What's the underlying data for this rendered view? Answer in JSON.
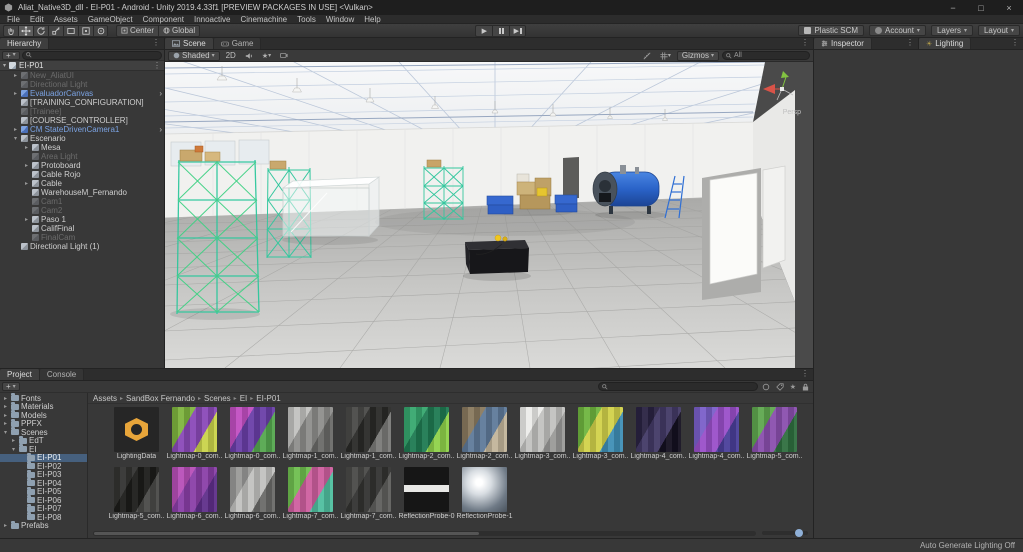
{
  "window": {
    "title": "Aliat_Native3D_dll - EI-P01 - Android - Unity 2019.4.33f1 [PREVIEW PACKAGES IN USE] <Vulkan>"
  },
  "menu": {
    "items": [
      "File",
      "Edit",
      "Assets",
      "GameObject",
      "Component",
      "Innoactive",
      "Cinemachine",
      "Tools",
      "Window",
      "Help"
    ]
  },
  "toolbar": {
    "pivot": "Center",
    "space": "Global",
    "plastic_scm": "Plastic SCM",
    "account": "Account",
    "layers": "Layers",
    "layout": "Layout"
  },
  "hierarchy": {
    "tab": "Hierarchy",
    "scene": "EI-P01",
    "items": [
      {
        "label": "New_AliatUI",
        "state": "disabled",
        "indent": 0,
        "arrow": "right",
        "prefab_open": false
      },
      {
        "label": "Directional Light",
        "state": "disabled",
        "indent": 0,
        "arrow": "none",
        "prefab_open": false
      },
      {
        "label": "EvaluadorCanvas",
        "state": "prefab",
        "indent": 0,
        "arrow": "right",
        "prefab_open": true
      },
      {
        "label": "[TRAINING_CONFIGURATION]",
        "state": "normal",
        "indent": 0,
        "arrow": "none",
        "prefab_open": false
      },
      {
        "label": "[Trainee]",
        "state": "disabled",
        "indent": 0,
        "arrow": "none",
        "prefab_open": false
      },
      {
        "label": "[COURSE_CONTROLLER]",
        "state": "normal",
        "indent": 0,
        "arrow": "none",
        "prefab_open": false
      },
      {
        "label": "CM StateDrivenCamera1",
        "state": "prefab",
        "indent": 0,
        "arrow": "right",
        "prefab_open": true
      },
      {
        "label": "Escenario",
        "state": "normal",
        "indent": 0,
        "arrow": "down",
        "prefab_open": false
      },
      {
        "label": "Mesa",
        "state": "normal",
        "indent": 1,
        "arrow": "right",
        "prefab_open": false
      },
      {
        "label": "Area Light",
        "state": "disabled",
        "indent": 1,
        "arrow": "none",
        "prefab_open": false
      },
      {
        "label": "Protoboard",
        "state": "normal",
        "indent": 1,
        "arrow": "right",
        "prefab_open": false
      },
      {
        "label": "Cable Rojo",
        "state": "normal",
        "indent": 1,
        "arrow": "none",
        "prefab_open": false
      },
      {
        "label": "Cable",
        "state": "normal",
        "indent": 1,
        "arrow": "right",
        "prefab_open": false
      },
      {
        "label": "WarehouseM_Fernando",
        "state": "normal",
        "indent": 1,
        "arrow": "none",
        "prefab_open": false
      },
      {
        "label": "Cam1",
        "state": "disabled",
        "indent": 1,
        "arrow": "none",
        "prefab_open": false
      },
      {
        "label": "Cam2",
        "state": "disabled",
        "indent": 1,
        "arrow": "none",
        "prefab_open": false
      },
      {
        "label": "Paso 1",
        "state": "normal",
        "indent": 1,
        "arrow": "right",
        "prefab_open": false
      },
      {
        "label": "CalifFinal",
        "state": "normal",
        "indent": 1,
        "arrow": "none",
        "prefab_open": false
      },
      {
        "label": "FinalCam",
        "state": "disabled",
        "indent": 1,
        "arrow": "none",
        "prefab_open": false
      },
      {
        "label": "Directional Light (1)",
        "state": "normal",
        "indent": 0,
        "arrow": "none",
        "prefab_open": false
      }
    ]
  },
  "scene_view": {
    "tabs": [
      {
        "label": "Scene",
        "active": true
      },
      {
        "label": "Game",
        "active": false
      }
    ],
    "shading": "Shaded",
    "toggle_2d": "2D",
    "gizmos": "Gizmos",
    "search_value": "All",
    "persp": "Persp"
  },
  "right_panels": {
    "inspector_tab": "Inspector",
    "lighting_tab": "Lighting"
  },
  "project": {
    "tabs": [
      {
        "label": "Project",
        "active": true
      },
      {
        "label": "Console",
        "active": false
      }
    ],
    "breadcrumb": [
      "Assets",
      "SandBox Fernando",
      "Scenes",
      "EI",
      "EI-P01"
    ],
    "folders": [
      {
        "label": "Fonts",
        "indent": 0,
        "arrow": "right",
        "selected": false
      },
      {
        "label": "Materials",
        "indent": 0,
        "arrow": "right",
        "selected": false
      },
      {
        "label": "Models",
        "indent": 0,
        "arrow": "right",
        "selected": false
      },
      {
        "label": "PPFX",
        "indent": 0,
        "arrow": "right",
        "selected": false
      },
      {
        "label": "Scenes",
        "indent": 0,
        "arrow": "down",
        "selected": false
      },
      {
        "label": "EdT",
        "indent": 1,
        "arrow": "right",
        "selected": false
      },
      {
        "label": "EI",
        "indent": 1,
        "arrow": "down",
        "selected": false
      },
      {
        "label": "EI-P01",
        "indent": 2,
        "arrow": "none",
        "selected": true
      },
      {
        "label": "EI-P02",
        "indent": 2,
        "arrow": "none",
        "selected": false
      },
      {
        "label": "EI-P03",
        "indent": 2,
        "arrow": "none",
        "selected": false
      },
      {
        "label": "EI-P04",
        "indent": 2,
        "arrow": "none",
        "selected": false
      },
      {
        "label": "EI-P05",
        "indent": 2,
        "arrow": "none",
        "selected": false
      },
      {
        "label": "EI-P06",
        "indent": 2,
        "arrow": "none",
        "selected": false
      },
      {
        "label": "EI-P07",
        "indent": 2,
        "arrow": "none",
        "selected": false
      },
      {
        "label": "EI-P08",
        "indent": 2,
        "arrow": "none",
        "selected": false
      },
      {
        "label": "Prefabs",
        "indent": 0,
        "arrow": "right",
        "selected": false
      }
    ],
    "assets": [
      {
        "label": "LightingData",
        "type": "lighting-data",
        "colors": [
          "#262626",
          "#e8a53a"
        ]
      },
      {
        "label": "Lightmap-0_com...",
        "type": "lightmap",
        "colors": [
          "#7fb53f",
          "#8a49b8",
          "#c9d34a"
        ]
      },
      {
        "label": "Lightmap-0_com...",
        "type": "lightmap",
        "colors": [
          "#c24fc2",
          "#6a3fa8",
          "#55a84f"
        ]
      },
      {
        "label": "Lightmap-1_com...",
        "type": "lightmap",
        "colors": [
          "#c2c2c0",
          "#8e8e8c",
          "#6a6a68"
        ]
      },
      {
        "label": "Lightmap-1_com...",
        "type": "lightmap",
        "colors": [
          "#4a4a48",
          "#2a2a28",
          "#7a7a78"
        ]
      },
      {
        "label": "Lightmap-2_com...",
        "type": "lightmap",
        "colors": [
          "#37a86f",
          "#1f7a52",
          "#8fd24a"
        ]
      },
      {
        "label": "Lightmap-2_com...",
        "type": "lightmap",
        "colors": [
          "#8a7a5f",
          "#5f7a9a",
          "#c2b49a"
        ]
      },
      {
        "label": "Lightmap-3_com...",
        "type": "lightmap",
        "colors": [
          "#ececea",
          "#c2c2c0",
          "#9a9a98"
        ]
      },
      {
        "label": "Lightmap-3_com...",
        "type": "lightmap",
        "colors": [
          "#6fb53f",
          "#d2d24a",
          "#3f8fb5"
        ]
      },
      {
        "label": "Lightmap-4_com...",
        "type": "lightmap",
        "colors": [
          "#2a2342",
          "#433a66",
          "#141020"
        ]
      },
      {
        "label": "Lightmap-4_com...",
        "type": "lightmap",
        "colors": [
          "#7a5fc9",
          "#9a4fc9",
          "#4a3f9a"
        ]
      },
      {
        "label": "Lightmap-5_com...",
        "type": "lightmap",
        "colors": [
          "#5fa84f",
          "#8a4fae",
          "#2f6f3f"
        ]
      },
      {
        "label": "Lightmap-5_com...",
        "type": "lightmap",
        "colors": [
          "#333331",
          "#1c1c1a",
          "#4a4a48"
        ]
      },
      {
        "label": "Lightmap-6_com...",
        "type": "lightmap",
        "colors": [
          "#b84fb8",
          "#8a3fa8",
          "#5f2f8a"
        ]
      },
      {
        "label": "Lightmap-6_com...",
        "type": "lightmap",
        "colors": [
          "#9a9a98",
          "#c2c2c0",
          "#6a6a68"
        ]
      },
      {
        "label": "Lightmap-7_com...",
        "type": "lightmap",
        "colors": [
          "#6fbf4f",
          "#cf5f9f",
          "#4fbf9f"
        ]
      },
      {
        "label": "Lightmap-7_com...",
        "type": "lightmap",
        "colors": [
          "#4a4a48",
          "#333331",
          "#5f5f5d"
        ]
      },
      {
        "label": "ReflectionProbe-0",
        "type": "probe-flat",
        "colors": [
          "#e8e8e6",
          "#161616"
        ]
      },
      {
        "label": "ReflectionProbe-1",
        "type": "probe-sphere",
        "colors": [
          "#d8dde2",
          "#6f7a86"
        ]
      }
    ]
  },
  "status_bar": {
    "right_label": "Auto Generate Lighting Off"
  }
}
